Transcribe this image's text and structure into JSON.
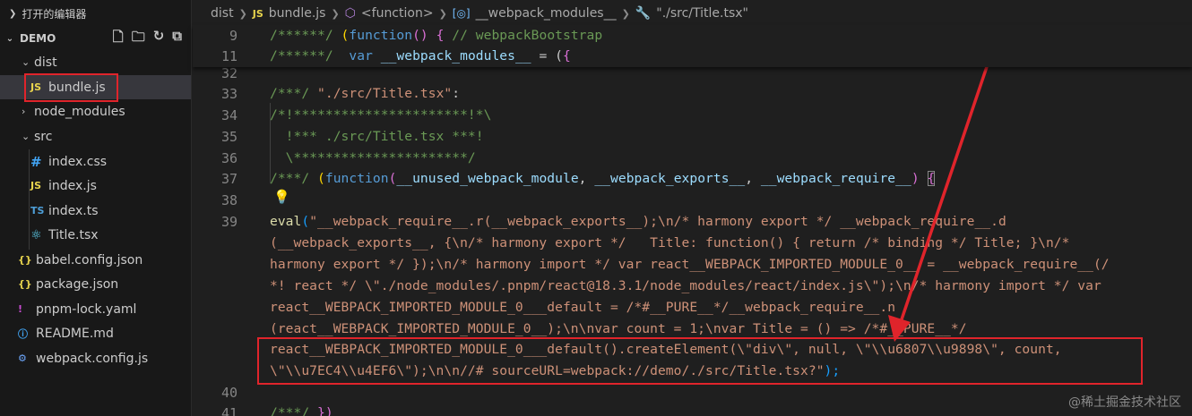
{
  "sidebar": {
    "open_editors_label": "打开的编辑器",
    "project_label": "DEMO",
    "actions": {
      "new_file": "new-file-icon",
      "new_folder": "new-folder-icon",
      "refresh": "refresh-icon",
      "collapse": "collapse-all-icon"
    },
    "tree": [
      {
        "name": "dist",
        "type": "folder",
        "expanded": true
      },
      {
        "name": "bundle.js",
        "type": "js",
        "icon_text": "JS",
        "selected": true
      },
      {
        "name": "node_modules",
        "type": "folder",
        "expanded": false
      },
      {
        "name": "src",
        "type": "folder",
        "expanded": true
      },
      {
        "name": "index.css",
        "type": "css",
        "icon_text": "#"
      },
      {
        "name": "index.js",
        "type": "js",
        "icon_text": "JS"
      },
      {
        "name": "index.ts",
        "type": "ts",
        "icon_text": "TS"
      },
      {
        "name": "Title.tsx",
        "type": "tsx",
        "icon_text": "⚛"
      },
      {
        "name": "babel.config.json",
        "type": "json",
        "icon_text": "{}"
      },
      {
        "name": "package.json",
        "type": "json",
        "icon_text": "{}"
      },
      {
        "name": "pnpm-lock.yaml",
        "type": "yaml",
        "icon_text": "!"
      },
      {
        "name": "README.md",
        "type": "md",
        "icon_text": "ⓘ"
      },
      {
        "name": "webpack.config.js",
        "type": "cfg",
        "icon_text": "⚙"
      }
    ]
  },
  "breadcrumbs": {
    "folder": "dist",
    "file_icon": "JS",
    "file": "bundle.js",
    "fn": "<function>",
    "modules": "__webpack_modules__",
    "entry": "\"./src/Title.tsx\""
  },
  "sticky_lines": {
    "n1": "9",
    "n2": "11",
    "l1_comment": "/******/",
    "l1_open": "(",
    "l1_kw": "function",
    "l1_rest": "() { ",
    "l1_trail": "// webpackBootstrap",
    "l2_comment": "/******/",
    "l2_kw": "var",
    "l2_var": "__webpack_modules__",
    "l2_rest": " = (",
    "l2_brace": "{"
  },
  "code": {
    "ln32": "32",
    "ln33": "33",
    "l33_c": "/***/",
    "l33_s": "\"./src/Title.tsx\"",
    "l33_p": ":",
    "ln34": "34",
    "l34": "/*!**********************!*\\",
    "ln35": "35",
    "l35": "  !*** ./src/Title.tsx ***!",
    "ln36": "36",
    "l36": "  \\**********************/",
    "ln37": "37",
    "l37_c": "/***/",
    "l37_open": "(",
    "l37_kw": "function",
    "l37_p1": "(",
    "l37_a1": "__unused_webpack_module",
    "l37_a2": "__webpack_exports__",
    "l37_a3": "__webpack_require__",
    "l37_p2": ")",
    "l37_brace": "{",
    "ln38": "38",
    "bulb": "💡",
    "ln39": "39",
    "eval_fn": "eval",
    "eval_open": "(",
    "w1": "\"__webpack_require__.r(__webpack_exports__);\\n/* harmony export */ __webpack_require__.d",
    "w2": "(__webpack_exports__, {\\n/* harmony export */   Title: function() { return /* binding */ Title; }\\n/*",
    "w3": "harmony export */ });\\n/* harmony import */ var react__WEBPACK_IMPORTED_MODULE_0__ = __webpack_require__(/",
    "w4": "*! react */ \\\"./node_modules/.pnpm/react@18.3.1/node_modules/react/index.js\\\");\\n/* harmony import */ var",
    "w5": "react__WEBPACK_IMPORTED_MODULE_0___default = /*#__PURE__*/__webpack_require__.n",
    "w6": "(react__WEBPACK_IMPORTED_MODULE_0__);\\n\\nvar count = 1;\\nvar Title = () => /*#__PURE__*/",
    "w7": "react__WEBPACK_IMPORTED_MODULE_0___default().createElement(\\\"div\\\", null, \\\"\\\\u6807\\\\u9898\\\", count,",
    "w8": "\\\"\\\\u7EC4\\\\u4EF6\\\");\\n\\n//# sourceURL=webpack://demo/./src/Title.tsx?\"",
    "w8_end": ");",
    "ln40": "40",
    "ln41": "41",
    "l41_c": "/***/",
    "l41_end": "})"
  },
  "watermark": "@稀土掘金技术社区",
  "colors": {
    "annotation": "#e0242b",
    "editor_bg": "#1f1f1f",
    "sidebar_bg": "#181818",
    "selected_row": "#37373d"
  }
}
